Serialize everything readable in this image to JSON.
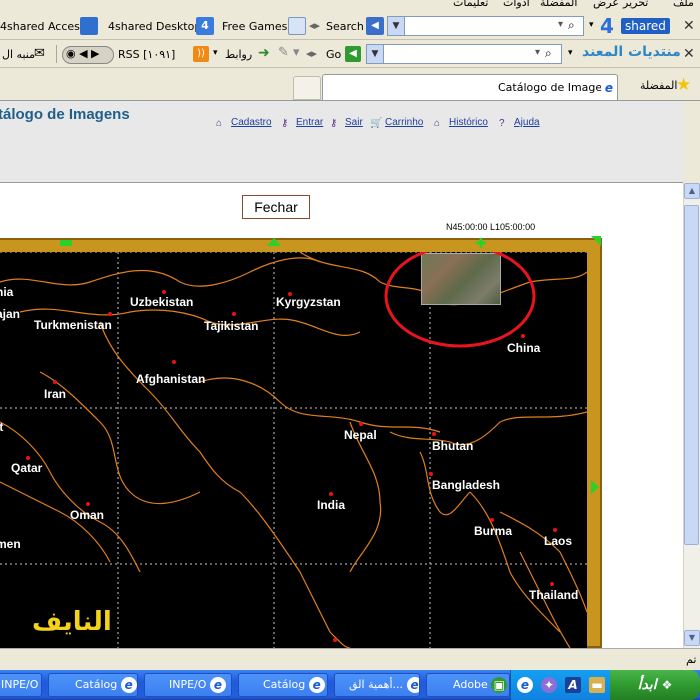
{
  "menubar": {
    "items": [
      "تعليمات",
      "أدوات",
      "المفضلة",
      "عرض",
      "تحرير",
      "ملف"
    ]
  },
  "toolbar1": {
    "shared_access": "4shared Access",
    "shared_desktop": "4shared Desktop",
    "free_games": "Free Games",
    "search_label": "Search",
    "search_value": "",
    "brand_digit": "4",
    "brand_text": "shared"
  },
  "toolbar2": {
    "rss_label": "RSS [١٠٩١]",
    "links_label": "روابط",
    "go_label": "Go",
    "forum_title": "منتديات المعند",
    "left_menu": "منبه ال"
  },
  "tabs": {
    "favorites": "المفضلة",
    "current_tab": "Catálogo de Imagens"
  },
  "page": {
    "title": "tálogo de Imagens",
    "nav": [
      "Cadastro",
      "Entrar",
      "Sair",
      "Carrinho",
      "Histórico",
      "Ajuda"
    ],
    "close_button": "Fechar",
    "coords": "N45:00:00 L105:00:00"
  },
  "map": {
    "countries": [
      "hia",
      "ajan",
      "Uzbekistan",
      "Turkmenistan",
      "Kyrgyzstan",
      "Tajikistan",
      "China",
      "Afghanistan",
      "Iran",
      "it",
      "Nepal",
      "Bhutan",
      "Qatar",
      "Bangladesh",
      "India",
      "Oman",
      "Burma",
      "Laos",
      "men",
      "Thailand"
    ],
    "watermark": "النايف"
  },
  "statusbar": {
    "text": "تم"
  },
  "taskbar": {
    "tasks": [
      "INPE/O",
      "Catálog",
      "INPE/O",
      "Catálog",
      "أهمية الق...",
      "Adobe"
    ],
    "start_label": "ابدأ"
  }
}
